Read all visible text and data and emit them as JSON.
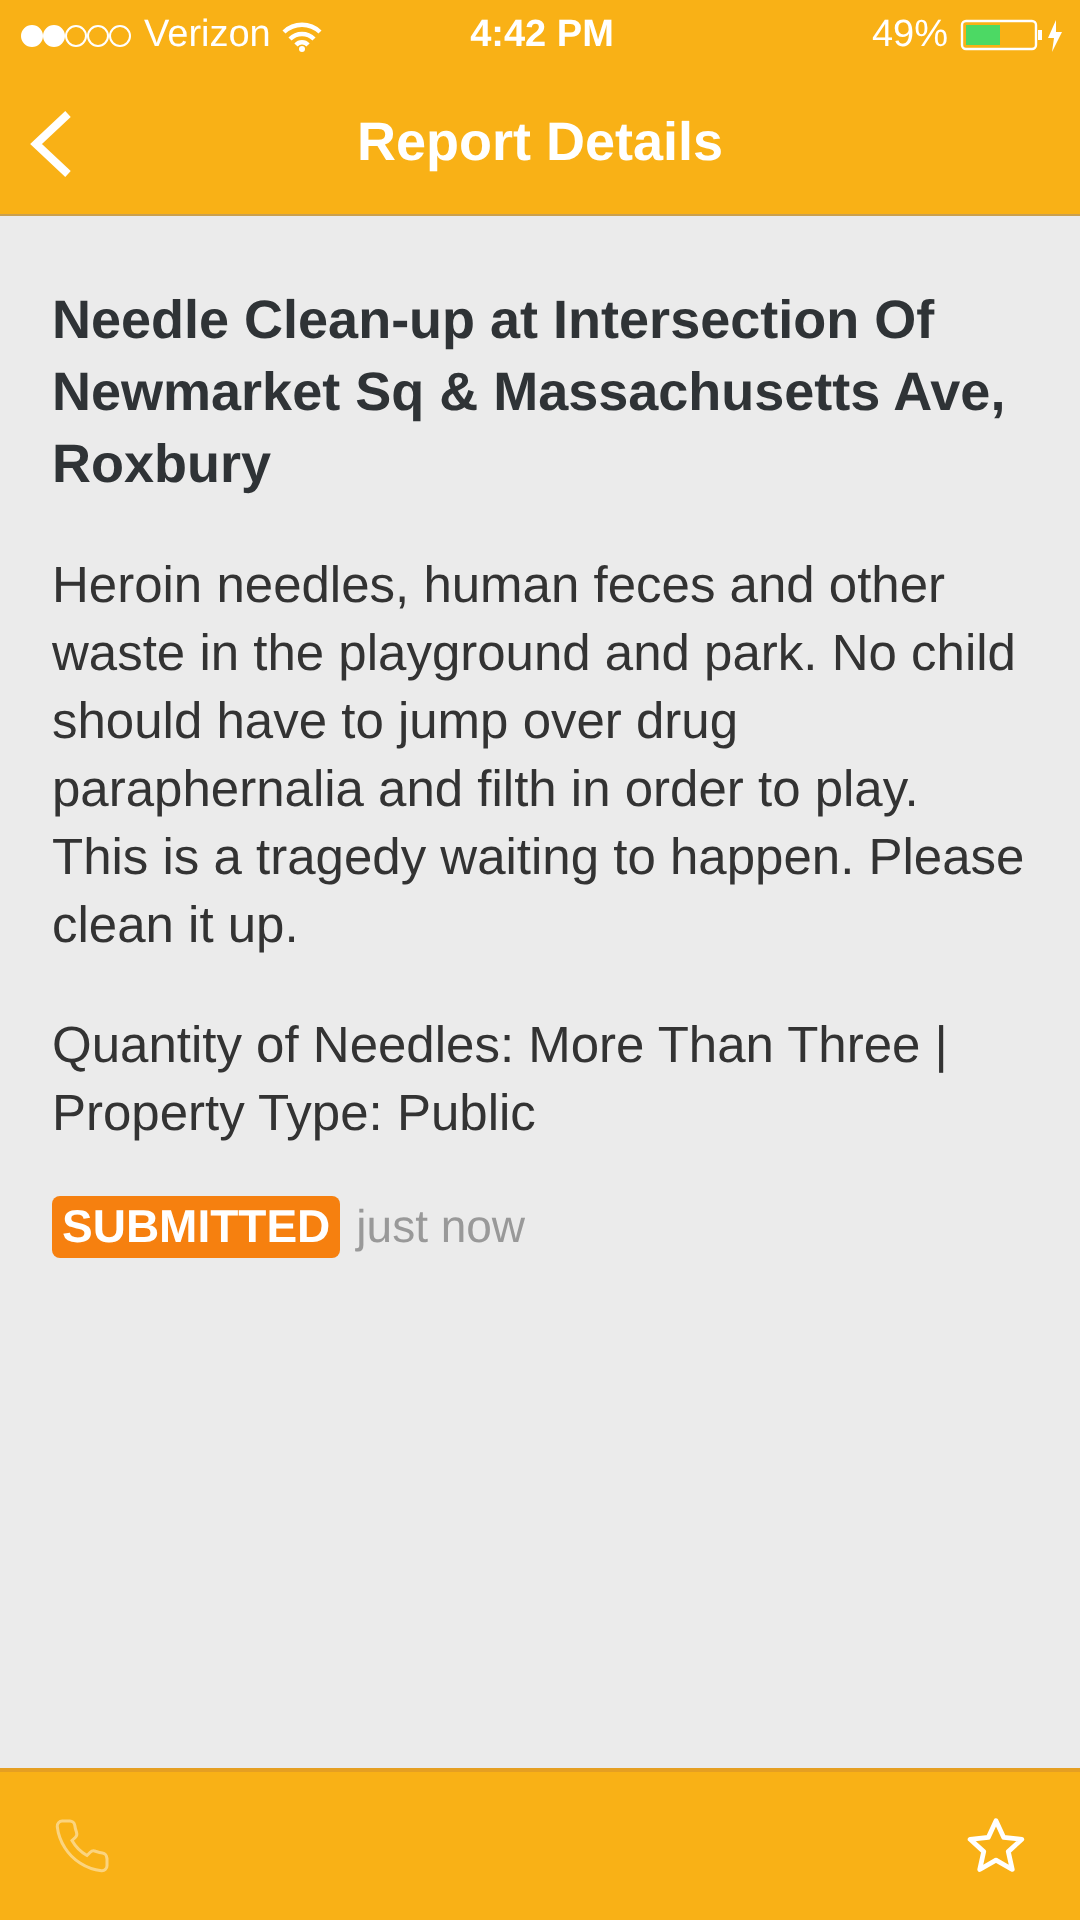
{
  "status_bar": {
    "carrier": "Verizon",
    "time": "4:42 PM",
    "battery": "49%"
  },
  "nav": {
    "title": "Report Details"
  },
  "report": {
    "title": "Needle Clean-up at Intersection Of Newmarket Sq & Massachusetts Ave, Roxbury",
    "description": "Heroin needles, human feces and other waste in the playground and park. No child should have to jump over drug paraphernalia and filth in order to play. This is a tragedy waiting to happen. Please clean it up.",
    "details": "Quantity of Needles: More Than Three | Property Type: Public",
    "status": "SUBMITTED",
    "time": "just now"
  },
  "bottom_bar": {
    "call_disabled": true,
    "starred": false
  }
}
